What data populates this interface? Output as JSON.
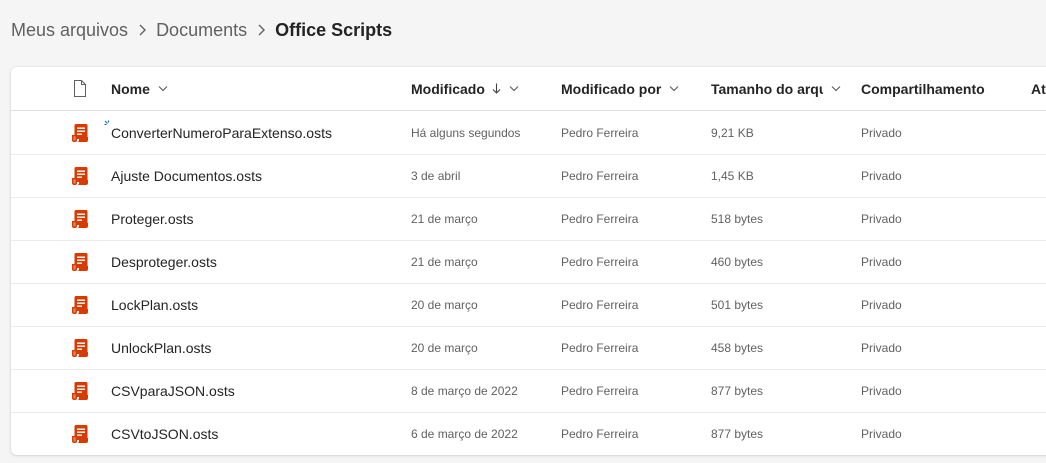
{
  "breadcrumb": {
    "items": [
      "Meus arquivos",
      "Documents",
      "Office Scripts"
    ]
  },
  "columns": {
    "name": "Nome",
    "modified": "Modificado",
    "modified_by": "Modificado por",
    "size": "Tamanho do arquivo",
    "sharing": "Compartilhamento",
    "activity": "Atividade"
  },
  "icons": {
    "file_type_header": "document-icon",
    "file": "office-script-file-icon",
    "sort": "arrow-down-icon",
    "column_menu": "chevron-down-icon"
  },
  "colors": {
    "script_icon": "#d83b01",
    "new_indicator": "#0f6cbd"
  },
  "files": [
    {
      "name": "ConverterNumeroParaExtenso.osts",
      "modified": "Há alguns segundos",
      "modified_by": "Pedro Ferreira",
      "size": "9,21 KB",
      "sharing": "Privado",
      "is_new": true
    },
    {
      "name": "Ajuste Documentos.osts",
      "modified": "3 de abril",
      "modified_by": "Pedro Ferreira",
      "size": "1,45 KB",
      "sharing": "Privado"
    },
    {
      "name": "Proteger.osts",
      "modified": "21 de março",
      "modified_by": "Pedro Ferreira",
      "size": "518 bytes",
      "sharing": "Privado"
    },
    {
      "name": "Desproteger.osts",
      "modified": "21 de março",
      "modified_by": "Pedro Ferreira",
      "size": "460 bytes",
      "sharing": "Privado"
    },
    {
      "name": "LockPlan.osts",
      "modified": "20 de março",
      "modified_by": "Pedro Ferreira",
      "size": "501 bytes",
      "sharing": "Privado"
    },
    {
      "name": "UnlockPlan.osts",
      "modified": "20 de março",
      "modified_by": "Pedro Ferreira",
      "size": "458 bytes",
      "sharing": "Privado"
    },
    {
      "name": "CSVparaJSON.osts",
      "modified": "8 de março de 2022",
      "modified_by": "Pedro Ferreira",
      "size": "877 bytes",
      "sharing": "Privado"
    },
    {
      "name": "CSVtoJSON.osts",
      "modified": "6 de março de 2022",
      "modified_by": "Pedro Ferreira",
      "size": "877 bytes",
      "sharing": "Privado"
    }
  ]
}
